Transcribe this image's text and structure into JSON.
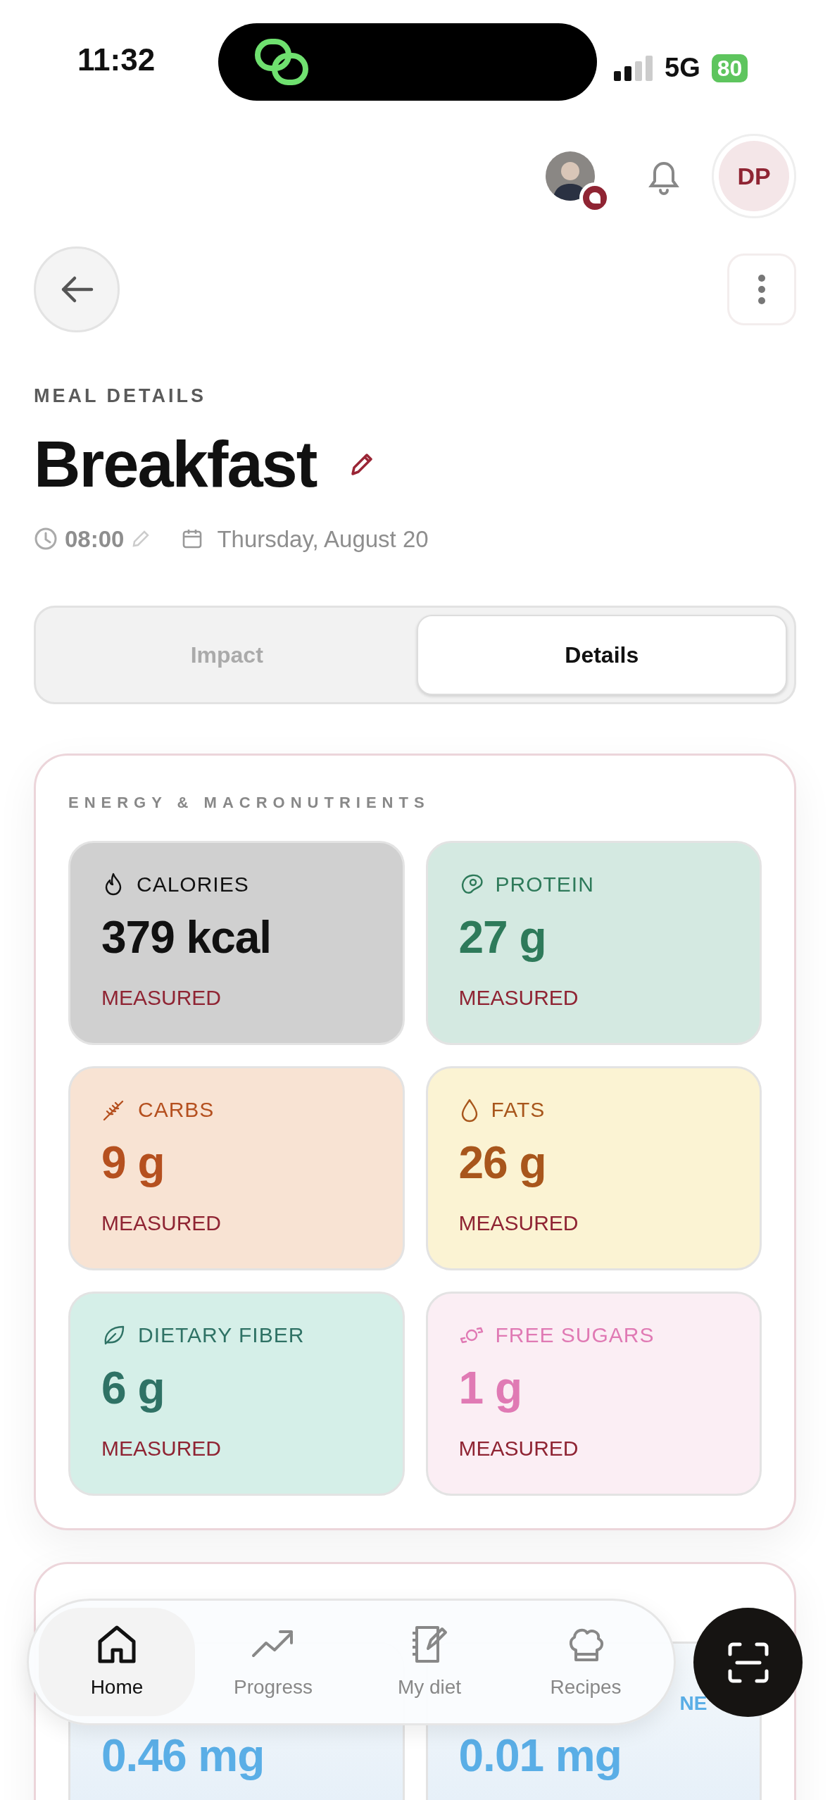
{
  "status_bar": {
    "time": "11:32",
    "network": "5G",
    "battery": "80"
  },
  "header": {
    "initials": "DP",
    "has_message": true
  },
  "meal": {
    "eyebrow": "MEAL DETAILS",
    "title": "Breakfast",
    "time": "08:00",
    "date": "Thursday, August 20"
  },
  "tabs": [
    {
      "label": "Impact",
      "selected": false
    },
    {
      "label": "Details",
      "selected": true
    }
  ],
  "sections": [
    {
      "title": "ENERGY & MACRONUTRIENTS",
      "tiles": [
        {
          "kind": "calories",
          "label": "CALORIES",
          "value": "379 kcal",
          "note": "MEASURED"
        },
        {
          "kind": "protein",
          "label": "PROTEIN",
          "value": "27 g",
          "note": "MEASURED"
        },
        {
          "kind": "carbs",
          "label": "CARBS",
          "value": "9 g",
          "note": "MEASURED"
        },
        {
          "kind": "fats",
          "label": "FATS",
          "value": "26 g",
          "note": "MEASURED"
        },
        {
          "kind": "fiber",
          "label": "DIETARY FIBER",
          "value": "6 g",
          "note": "MEASURED"
        },
        {
          "kind": "sugars",
          "label": "FREE SUGARS",
          "value": "1 g",
          "note": "MEASURED"
        }
      ]
    },
    {
      "tiles": [
        {
          "kind": "mineral",
          "value": "0.46 mg"
        },
        {
          "kind": "mineral",
          "label": "NE",
          "value": "0.01 mg"
        }
      ]
    }
  ],
  "nav": [
    {
      "kind": "home",
      "label": "Home",
      "selected": true
    },
    {
      "kind": "progress",
      "label": "Progress",
      "selected": false
    },
    {
      "kind": "diet",
      "label": "My diet",
      "selected": false
    },
    {
      "kind": "recipes",
      "label": "Recipes",
      "selected": false
    }
  ]
}
